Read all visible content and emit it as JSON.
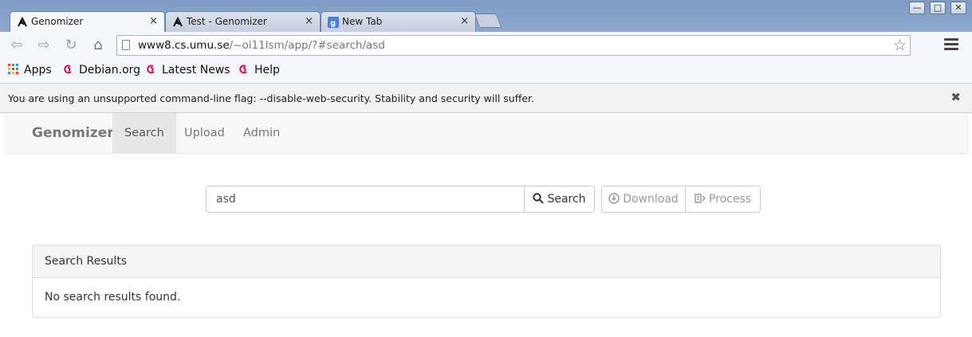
{
  "browser": {
    "tabs": [
      {
        "title": "Genomizer",
        "active": true
      },
      {
        "title": "Test - Genomizer",
        "active": false
      },
      {
        "title": "New Tab",
        "active": false
      }
    ],
    "tab_close": "×",
    "window_buttons": {
      "minimize": "—",
      "maximize": "□",
      "close": "✕"
    },
    "url_host": "www8.cs.umu.se",
    "url_path": "/~oi11lsm/app/?#search/asd",
    "bookmarks": [
      "Apps",
      "Debian.org",
      "Latest News",
      "Help"
    ],
    "infobar_message": "You are using an unsupported command-line flag: --disable-web-security. Stability and security will suffer.",
    "infobar_close": "✖"
  },
  "app": {
    "brand": "Genomizer",
    "nav": [
      "Search",
      "Upload",
      "Admin"
    ],
    "active_nav": "Search",
    "search": {
      "value": "asd",
      "button": "Search"
    },
    "actions": {
      "download": "Download",
      "process": "Process"
    },
    "results": {
      "title": "Search Results",
      "empty_message": "No search results found."
    }
  },
  "colors": {
    "accent_debian": "#d70a53",
    "navbar_bg": "#f8f8f8"
  }
}
